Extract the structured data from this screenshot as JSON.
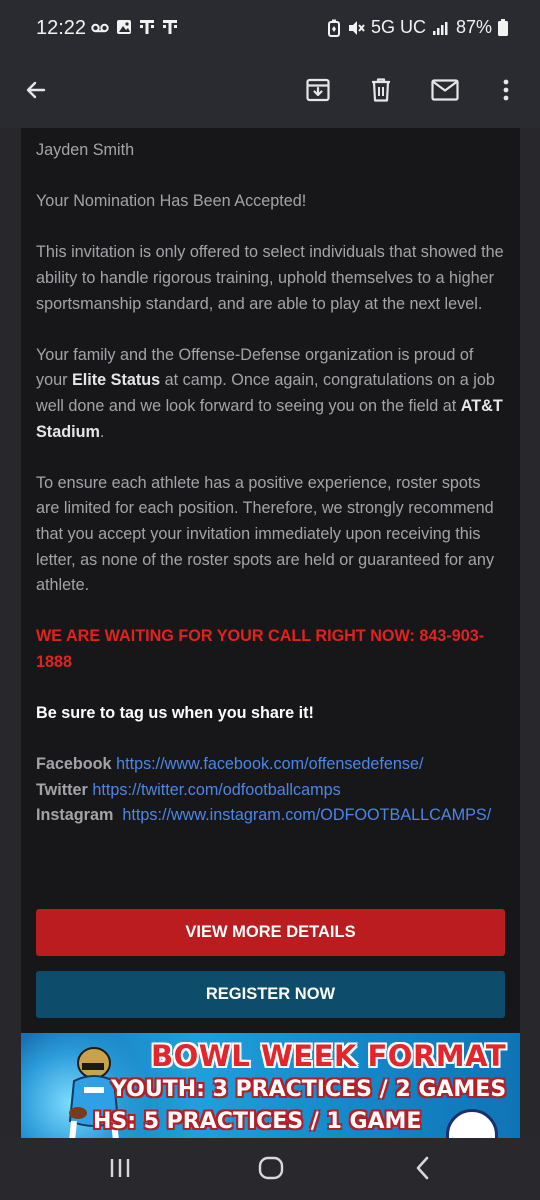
{
  "status_bar": {
    "time": "12:22",
    "network": "5G UC",
    "battery": "87%",
    "left_icons": [
      "voicemail-icon",
      "photo-icon",
      "tmobile-icon",
      "tmobile-icon"
    ],
    "right_icons": [
      "battery-saver-icon",
      "mute-icon",
      "signal-icon",
      "battery-icon"
    ]
  },
  "app_bar": {
    "icons": [
      "back-arrow-icon",
      "archive-icon",
      "delete-icon",
      "mark-unread-icon",
      "more-vert-icon"
    ]
  },
  "email": {
    "greeting": "Jayden Smith",
    "headline": "Your Nomination Has Been Accepted!",
    "para1": "This invitation is only offered to select individuals that showed the ability to handle rigorous training, uphold themselves to a higher sportsmanship standard, and are able to play at the next level.",
    "para2": {
      "part1": "Your family and the Offense-Defense organization is proud of your ",
      "bold1": "Elite Status",
      "part2": " at camp. Once again, congratulations on a job well done and we look forward to seeing you on the field at ",
      "bold2": "AT&T Stadium",
      "part3": "."
    },
    "para3": "To ensure each athlete has a positive experience, roster spots are limited for each position. Therefore, we strongly recommend that you accept your invitation immediately upon receiving this letter, as none of the roster spots are held or guaranteed for any athlete.",
    "call_to_action": "WE ARE WAITING FOR YOUR CALL RIGHT NOW: 843-903-1888",
    "tag_line": "Be sure to tag us when you share it!",
    "social": [
      {
        "label": "Facebook",
        "url": "https://www.facebook.com/offensedefense/"
      },
      {
        "label": "Twitter",
        "url": "https://twitter.com/odfootballcamps"
      },
      {
        "label": "Instagram",
        "url": "https://www.instagram.com/ODFOOTBALLCAMPS/"
      }
    ],
    "button_details": "VIEW MORE DETAILS",
    "button_register": "REGISTER NOW"
  },
  "banner": {
    "line1": "BOWL WEEK FORMAT",
    "line2": "YOUTH: 3 PRACTICES / 2 GAMES",
    "line3": "HS: 5 PRACTICES / 1 GAME"
  },
  "nav_bar": {
    "icons": [
      "recents-icon",
      "home-icon",
      "back-icon"
    ]
  },
  "colors": {
    "alert_red": "#e3221c",
    "link_blue": "#4d86e6",
    "button_red": "#bb1c20",
    "button_blue": "#0d4c6b",
    "card_bg": "#17171a"
  }
}
